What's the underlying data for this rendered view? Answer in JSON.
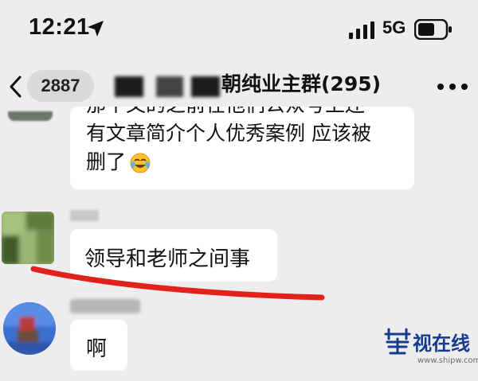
{
  "status_bar": {
    "time": "12:21",
    "network": "5G"
  },
  "header": {
    "back_count": "2887",
    "title": "朝纯业主群(295)"
  },
  "messages": [
    {
      "partial_line": "那个文的之前在他们公众号上还",
      "lines": [
        "有文章简介个人优秀案例 应该被",
        "删了"
      ],
      "emoji": "laughing-crying-emoji"
    },
    {
      "text": "领导和老师之间事"
    },
    {
      "text": "啊"
    }
  ],
  "watermark": {
    "brand": "视在线",
    "url": "www.shipw.com"
  },
  "colors": {
    "background": "#ededed",
    "bubble": "#ffffff",
    "underline": "#e0221b",
    "watermark": "#163a8c"
  }
}
